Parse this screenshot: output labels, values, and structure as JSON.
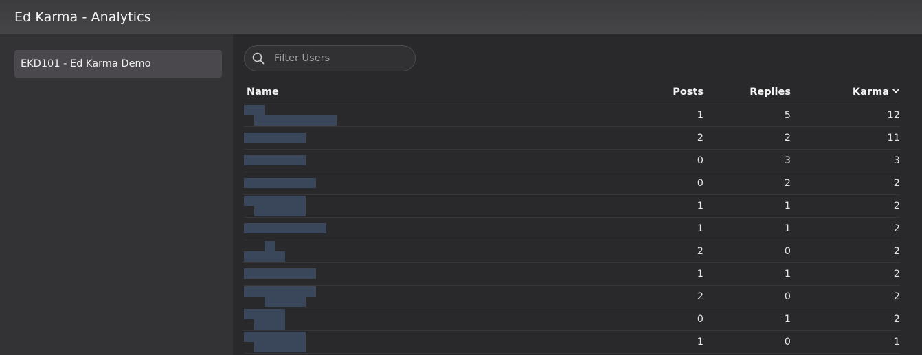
{
  "window": {
    "title": "Ed Karma - Analytics"
  },
  "sidebar": {
    "items": [
      {
        "label": "EKD101 - Ed Karma Demo"
      }
    ]
  },
  "filter": {
    "placeholder": "Filter Users",
    "value": ""
  },
  "table": {
    "columns": [
      "Name",
      "Posts",
      "Replies",
      "Karma"
    ],
    "sort_column": "Karma",
    "sort_direction": "descending",
    "rows": [
      {
        "posts": "1",
        "replies": "5",
        "karma": "12"
      },
      {
        "posts": "2",
        "replies": "2",
        "karma": "11"
      },
      {
        "posts": "0",
        "replies": "3",
        "karma": "3"
      },
      {
        "posts": "0",
        "replies": "2",
        "karma": "2"
      },
      {
        "posts": "1",
        "replies": "1",
        "karma": "2"
      },
      {
        "posts": "1",
        "replies": "1",
        "karma": "2"
      },
      {
        "posts": "2",
        "replies": "0",
        "karma": "2"
      },
      {
        "posts": "1",
        "replies": "1",
        "karma": "2"
      },
      {
        "posts": "2",
        "replies": "0",
        "karma": "2"
      },
      {
        "posts": "0",
        "replies": "1",
        "karma": "2"
      },
      {
        "posts": "1",
        "replies": "0",
        "karma": "1"
      }
    ]
  },
  "colors": {
    "titlebar": "#424244",
    "sidebar": "#333336",
    "main": "#29292c",
    "selected_item": "#4a484d",
    "redacted_name": "#3a4659"
  },
  "icons": {
    "search": "search-icon",
    "sort": "chevron-down-icon"
  }
}
